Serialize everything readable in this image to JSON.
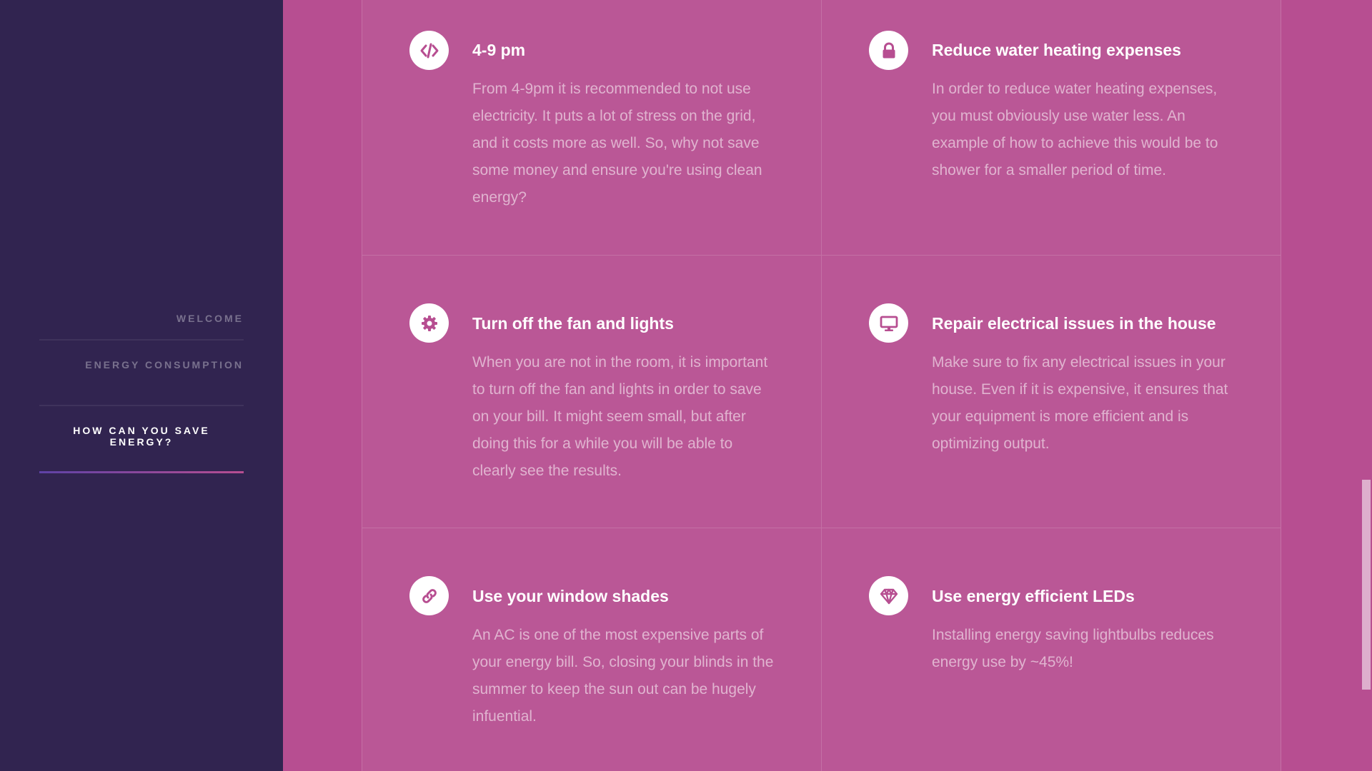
{
  "nav": {
    "items": [
      {
        "label": "WELCOME"
      },
      {
        "label": "ENERGY CONSUMPTION"
      },
      {
        "label": "HOW CAN YOU SAVE ENERGY?"
      }
    ],
    "active_index": 2
  },
  "features": [
    {
      "icon": "code-icon",
      "title": "4-9 pm",
      "body": "From 4-9pm it is recommended to not use electricity. It puts a lot of stress on the grid, and it costs more as well. So, why not save some money and ensure you're using clean energy?"
    },
    {
      "icon": "lock-icon",
      "title": "Reduce water heating expenses",
      "body": "In order to reduce water heating expenses, you must obviously use water less. An example of how to achieve this would be to shower for a smaller period of time."
    },
    {
      "icon": "gear-icon",
      "title": "Turn off the fan and lights",
      "body": "When you are not in the room, it is important to turn off the fan and lights in order to save on your bill. It might seem small, but after doing this for a while you will be able to clearly see the results."
    },
    {
      "icon": "desktop-icon",
      "title": "Repair electrical issues in the house",
      "body": "Make sure to fix any electrical issues in your house. Even if it is expensive, it ensures that your equipment is more efficient and is optimizing output."
    },
    {
      "icon": "link-icon",
      "title": "Use your window shades",
      "body": "An AC is one of the most expensive parts of your energy bill. So, closing your blinds in the summer to keep the sun out can be hugely infuential."
    },
    {
      "icon": "diamond-icon",
      "title": "Use energy efficient LEDs",
      "body": "Installing energy saving lightbulbs reduces energy use by ~45%!"
    }
  ],
  "colors": {
    "sidebar": "#312450",
    "background": "#b74e91",
    "icon": "#b74e91"
  }
}
